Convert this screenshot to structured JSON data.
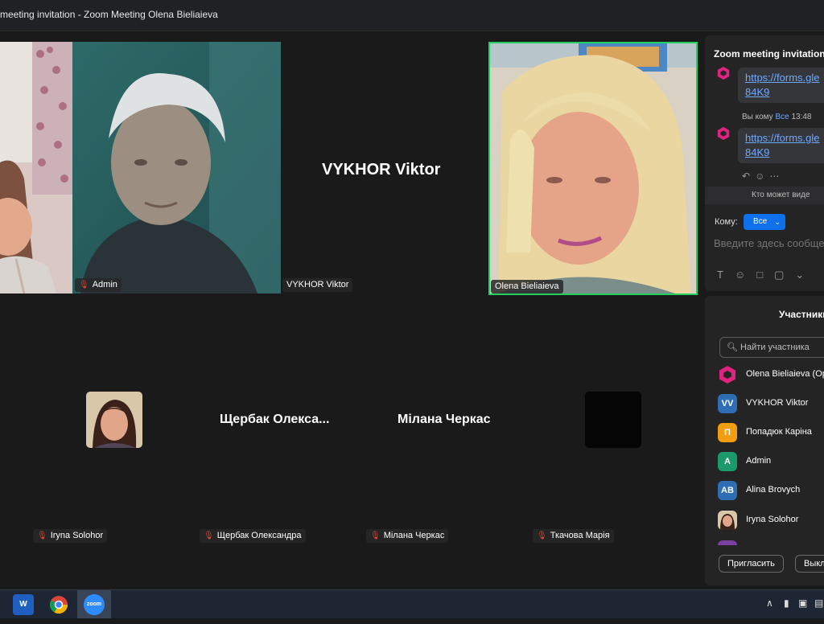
{
  "window": {
    "title": "meeting invitation - Zoom Meeting Olena Bieliaieva"
  },
  "video_tiles": [
    {
      "name": "Admin",
      "muted": true
    },
    {
      "name": "VYKHOR Viktor",
      "display_name": "VYKHOR Viktor",
      "muted": false
    },
    {
      "name": "Olena Bieliaieva",
      "muted": false,
      "active_speaker": true
    }
  ],
  "gallery_tiles": [
    {
      "name": "Iryna Solohor",
      "muted": true
    },
    {
      "name": "Щербак Олександра",
      "display_name": "Щербак  Олекса...",
      "muted": true
    },
    {
      "name": "Мілана Черкас",
      "display_name": "Мілана Черкас",
      "muted": true
    },
    {
      "name": "Ткачова Марія",
      "muted": true
    }
  ],
  "chat": {
    "title": "Zoom meeting invitation",
    "messages": [
      {
        "link_text": "https://forms.gle",
        "link_cont": "84K9"
      },
      {
        "link_text": "https://forms.gle",
        "link_cont": "84K9"
      }
    ],
    "meta_prefix": "Вы кому",
    "meta_to": "Все",
    "meta_time": "13:48",
    "who_can_see": "Кто может виде",
    "to_label": "Кому:",
    "to_value": "Все",
    "input_placeholder": "Введите здесь сообще"
  },
  "participants": {
    "title": "Участники",
    "search_placeholder": "Найти участника",
    "list": [
      {
        "initials": "",
        "name": "Olena Bieliaieva (Op",
        "color": "#e0237f"
      },
      {
        "initials": "VV",
        "name": "VYKHOR Viktor",
        "color": "#2f6db4"
      },
      {
        "initials": "П",
        "name": "Попадюк Каріна",
        "color": "#f29d0f"
      },
      {
        "initials": "A",
        "name": "Admin",
        "color": "#1d9a6c"
      },
      {
        "initials": "AB",
        "name": "Alina Brovych",
        "color": "#2f6db4"
      },
      {
        "initials": "",
        "name": "Iryna Solohor",
        "color": "#7a4b3a"
      }
    ],
    "invite_button": "Пригласить",
    "mute_button": "Выкл"
  }
}
